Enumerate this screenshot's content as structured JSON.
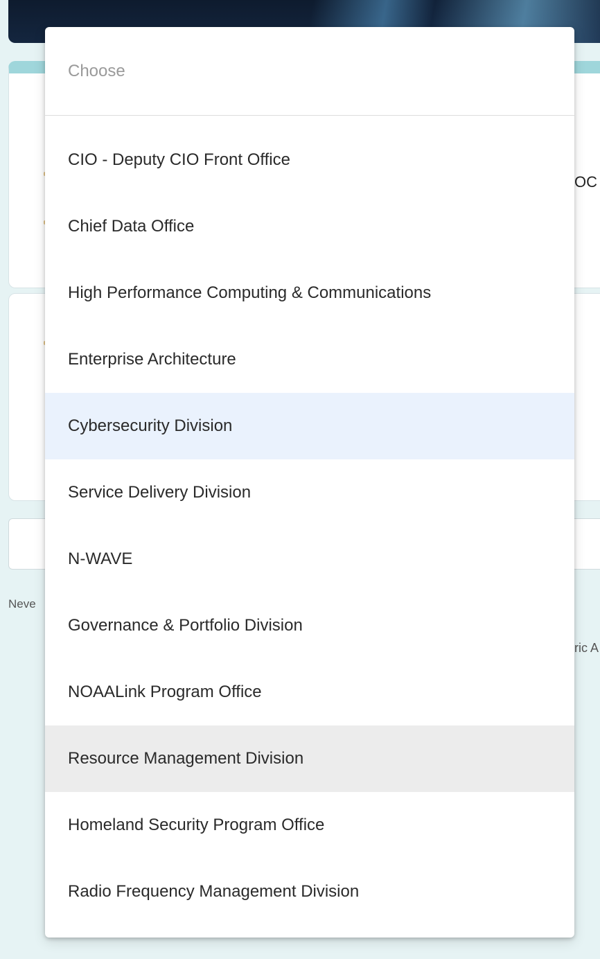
{
  "background": {
    "right_partial_top": "OC",
    "left_partial": "Neve",
    "right_partial_bottom": "ric A"
  },
  "dropdown": {
    "placeholder": "Choose",
    "options": [
      {
        "label": "CIO - Deputy CIO Front Office",
        "state": "normal"
      },
      {
        "label": "Chief Data Office",
        "state": "normal"
      },
      {
        "label": "High Performance Computing & Communications",
        "state": "normal"
      },
      {
        "label": "Enterprise Architecture",
        "state": "normal"
      },
      {
        "label": "Cybersecurity Division",
        "state": "highlighted"
      },
      {
        "label": "Service Delivery Division",
        "state": "normal"
      },
      {
        "label": "N-WAVE",
        "state": "normal"
      },
      {
        "label": "Governance & Portfolio Division",
        "state": "normal"
      },
      {
        "label": "NOAALink Program Office",
        "state": "normal"
      },
      {
        "label": "Resource Management Division",
        "state": "hovered"
      },
      {
        "label": "Homeland Security Program Office",
        "state": "normal"
      },
      {
        "label": "Radio Frequency Management Division",
        "state": "normal"
      }
    ]
  },
  "colors": {
    "page_background": "#e6f3f4",
    "card_accent": "#9fd6db",
    "option_highlight": "#eaf2fd",
    "option_hover": "#ececec"
  }
}
